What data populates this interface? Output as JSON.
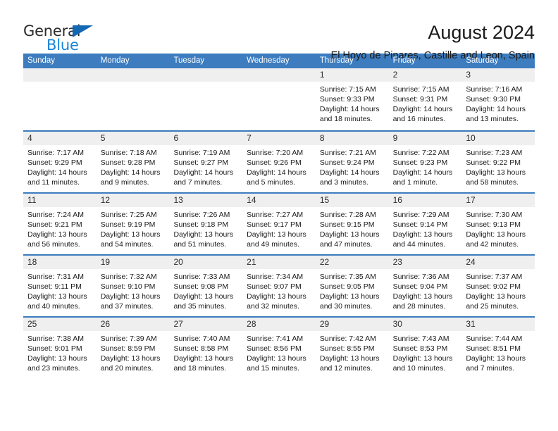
{
  "brand": {
    "name_part1": "General",
    "name_part2": "Blue",
    "triangle_color": "#1268b3",
    "blue_color": "#1a85d6"
  },
  "header": {
    "title": "August 2024",
    "subtitle": "El Hoyo de Pinares, Castille and Leon, Spain"
  },
  "theme": {
    "header_blue": "#3c7cbf",
    "daynum_gray": "#efefef"
  },
  "calendar": {
    "weekday_headers": [
      "Sunday",
      "Monday",
      "Tuesday",
      "Wednesday",
      "Thursday",
      "Friday",
      "Saturday"
    ],
    "weeks": [
      [
        {
          "day": "",
          "empty": true
        },
        {
          "day": "",
          "empty": true
        },
        {
          "day": "",
          "empty": true
        },
        {
          "day": "",
          "empty": true
        },
        {
          "day": "1",
          "sunrise": "Sunrise: 7:15 AM",
          "sunset": "Sunset: 9:33 PM",
          "daylight": "Daylight: 14 hours and 18 minutes."
        },
        {
          "day": "2",
          "sunrise": "Sunrise: 7:15 AM",
          "sunset": "Sunset: 9:31 PM",
          "daylight": "Daylight: 14 hours and 16 minutes."
        },
        {
          "day": "3",
          "sunrise": "Sunrise: 7:16 AM",
          "sunset": "Sunset: 9:30 PM",
          "daylight": "Daylight: 14 hours and 13 minutes."
        }
      ],
      [
        {
          "day": "4",
          "sunrise": "Sunrise: 7:17 AM",
          "sunset": "Sunset: 9:29 PM",
          "daylight": "Daylight: 14 hours and 11 minutes."
        },
        {
          "day": "5",
          "sunrise": "Sunrise: 7:18 AM",
          "sunset": "Sunset: 9:28 PM",
          "daylight": "Daylight: 14 hours and 9 minutes."
        },
        {
          "day": "6",
          "sunrise": "Sunrise: 7:19 AM",
          "sunset": "Sunset: 9:27 PM",
          "daylight": "Daylight: 14 hours and 7 minutes."
        },
        {
          "day": "7",
          "sunrise": "Sunrise: 7:20 AM",
          "sunset": "Sunset: 9:26 PM",
          "daylight": "Daylight: 14 hours and 5 minutes."
        },
        {
          "day": "8",
          "sunrise": "Sunrise: 7:21 AM",
          "sunset": "Sunset: 9:24 PM",
          "daylight": "Daylight: 14 hours and 3 minutes."
        },
        {
          "day": "9",
          "sunrise": "Sunrise: 7:22 AM",
          "sunset": "Sunset: 9:23 PM",
          "daylight": "Daylight: 14 hours and 1 minute."
        },
        {
          "day": "10",
          "sunrise": "Sunrise: 7:23 AM",
          "sunset": "Sunset: 9:22 PM",
          "daylight": "Daylight: 13 hours and 58 minutes."
        }
      ],
      [
        {
          "day": "11",
          "sunrise": "Sunrise: 7:24 AM",
          "sunset": "Sunset: 9:21 PM",
          "daylight": "Daylight: 13 hours and 56 minutes."
        },
        {
          "day": "12",
          "sunrise": "Sunrise: 7:25 AM",
          "sunset": "Sunset: 9:19 PM",
          "daylight": "Daylight: 13 hours and 54 minutes."
        },
        {
          "day": "13",
          "sunrise": "Sunrise: 7:26 AM",
          "sunset": "Sunset: 9:18 PM",
          "daylight": "Daylight: 13 hours and 51 minutes."
        },
        {
          "day": "14",
          "sunrise": "Sunrise: 7:27 AM",
          "sunset": "Sunset: 9:17 PM",
          "daylight": "Daylight: 13 hours and 49 minutes."
        },
        {
          "day": "15",
          "sunrise": "Sunrise: 7:28 AM",
          "sunset": "Sunset: 9:15 PM",
          "daylight": "Daylight: 13 hours and 47 minutes."
        },
        {
          "day": "16",
          "sunrise": "Sunrise: 7:29 AM",
          "sunset": "Sunset: 9:14 PM",
          "daylight": "Daylight: 13 hours and 44 minutes."
        },
        {
          "day": "17",
          "sunrise": "Sunrise: 7:30 AM",
          "sunset": "Sunset: 9:13 PM",
          "daylight": "Daylight: 13 hours and 42 minutes."
        }
      ],
      [
        {
          "day": "18",
          "sunrise": "Sunrise: 7:31 AM",
          "sunset": "Sunset: 9:11 PM",
          "daylight": "Daylight: 13 hours and 40 minutes."
        },
        {
          "day": "19",
          "sunrise": "Sunrise: 7:32 AM",
          "sunset": "Sunset: 9:10 PM",
          "daylight": "Daylight: 13 hours and 37 minutes."
        },
        {
          "day": "20",
          "sunrise": "Sunrise: 7:33 AM",
          "sunset": "Sunset: 9:08 PM",
          "daylight": "Daylight: 13 hours and 35 minutes."
        },
        {
          "day": "21",
          "sunrise": "Sunrise: 7:34 AM",
          "sunset": "Sunset: 9:07 PM",
          "daylight": "Daylight: 13 hours and 32 minutes."
        },
        {
          "day": "22",
          "sunrise": "Sunrise: 7:35 AM",
          "sunset": "Sunset: 9:05 PM",
          "daylight": "Daylight: 13 hours and 30 minutes."
        },
        {
          "day": "23",
          "sunrise": "Sunrise: 7:36 AM",
          "sunset": "Sunset: 9:04 PM",
          "daylight": "Daylight: 13 hours and 28 minutes."
        },
        {
          "day": "24",
          "sunrise": "Sunrise: 7:37 AM",
          "sunset": "Sunset: 9:02 PM",
          "daylight": "Daylight: 13 hours and 25 minutes."
        }
      ],
      [
        {
          "day": "25",
          "sunrise": "Sunrise: 7:38 AM",
          "sunset": "Sunset: 9:01 PM",
          "daylight": "Daylight: 13 hours and 23 minutes."
        },
        {
          "day": "26",
          "sunrise": "Sunrise: 7:39 AM",
          "sunset": "Sunset: 8:59 PM",
          "daylight": "Daylight: 13 hours and 20 minutes."
        },
        {
          "day": "27",
          "sunrise": "Sunrise: 7:40 AM",
          "sunset": "Sunset: 8:58 PM",
          "daylight": "Daylight: 13 hours and 18 minutes."
        },
        {
          "day": "28",
          "sunrise": "Sunrise: 7:41 AM",
          "sunset": "Sunset: 8:56 PM",
          "daylight": "Daylight: 13 hours and 15 minutes."
        },
        {
          "day": "29",
          "sunrise": "Sunrise: 7:42 AM",
          "sunset": "Sunset: 8:55 PM",
          "daylight": "Daylight: 13 hours and 12 minutes."
        },
        {
          "day": "30",
          "sunrise": "Sunrise: 7:43 AM",
          "sunset": "Sunset: 8:53 PM",
          "daylight": "Daylight: 13 hours and 10 minutes."
        },
        {
          "day": "31",
          "sunrise": "Sunrise: 7:44 AM",
          "sunset": "Sunset: 8:51 PM",
          "daylight": "Daylight: 13 hours and 7 minutes."
        }
      ]
    ]
  }
}
